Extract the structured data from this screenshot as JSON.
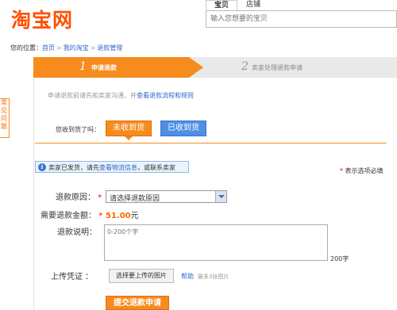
{
  "header": {
    "logo": "淘宝网",
    "search_tabs": [
      "宝贝",
      "店铺"
    ],
    "search_placeholder": "输入您想要的宝贝"
  },
  "breadcrumb": {
    "prefix": "您的位置：",
    "items": [
      "首页",
      "我的淘宝",
      "退款管理"
    ]
  },
  "steps": [
    {
      "num": "1",
      "label": "申请退款"
    },
    {
      "num": "2",
      "label": "卖家处理退款申请"
    }
  ],
  "side_help": [
    "常",
    "见",
    "问",
    "题"
  ],
  "notice": {
    "text": "申请退款前请先和卖家沟通，并",
    "link": "查看退款流程和规则"
  },
  "received": {
    "question": "您收到货了吗：",
    "no_label": "未收到货",
    "yes_label": "已收到货"
  },
  "info_bar": {
    "icon": "i",
    "text": "卖家已发货，请先",
    "link": "查看物流信息",
    "suffix": "，或联系卖家"
  },
  "required_note": "表示选项必填",
  "form": {
    "reason_label": "退款原因：",
    "reason_value": "请选择退款原因",
    "amount_label": "需要退款金额：",
    "amount_value": "51.00",
    "amount_unit": "元",
    "desc_label": "退款说明：",
    "desc_placeholder": "0-200个字",
    "char_limit": "200字",
    "upload_label": "上传凭证 ：",
    "upload_button": "选择要上传的图片",
    "help_link": "帮助",
    "upload_note": "最多3张图片",
    "submit": "提交退款申请"
  },
  "colors": {
    "brand": "#ff5000",
    "step_active": "#f68b1e",
    "link": "#3366cc",
    "blue_button": "#4d8fe6"
  }
}
